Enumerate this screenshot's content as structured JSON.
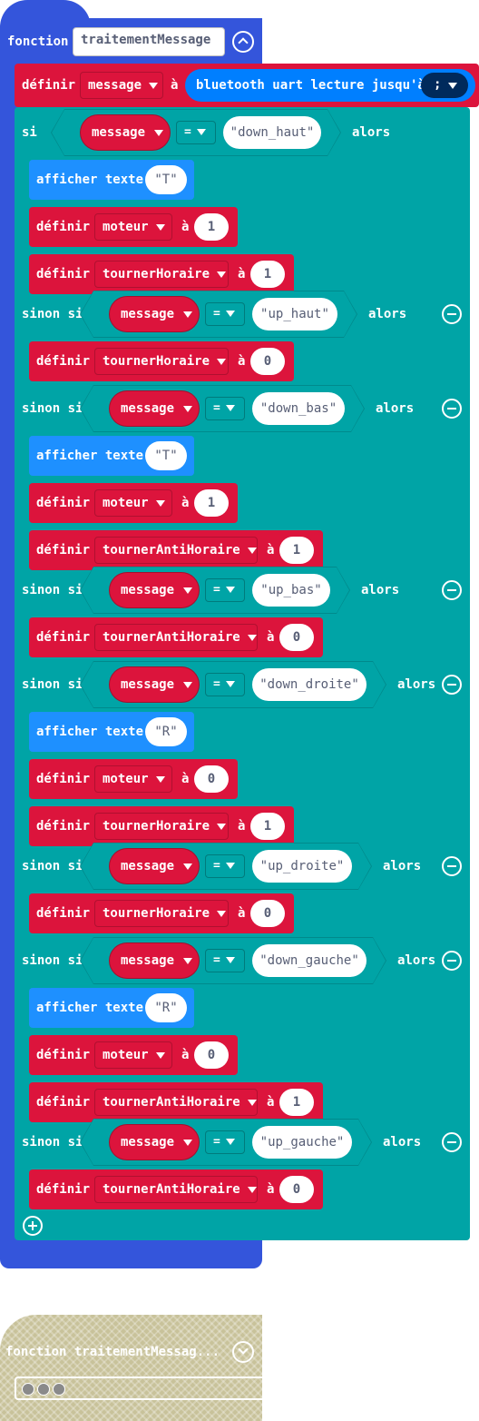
{
  "function_block": {
    "keyword": "fonction",
    "name": "traitementMessage",
    "collapse_icon": "chevron-up-icon"
  },
  "first_set": {
    "keyword": "définir",
    "variable": "message",
    "to": "à",
    "reader_block": "bluetooth uart lecture jusqu'à",
    "delimiter": ";"
  },
  "branches": [
    {
      "keyword": "si",
      "var": "message",
      "op": "=",
      "value": "down_haut",
      "then": "alors",
      "body": [
        {
          "type": "show",
          "label": "afficher texte",
          "text": "T"
        },
        {
          "type": "set",
          "label": "définir",
          "var": "moteur",
          "to": "à",
          "value": "1"
        },
        {
          "type": "set",
          "label": "définir",
          "var": "tournerHoraire",
          "to": "à",
          "value": "1"
        }
      ]
    },
    {
      "keyword": "sinon si",
      "var": "message",
      "op": "=",
      "value": "up_haut",
      "then": "alors",
      "body": [
        {
          "type": "set",
          "label": "définir",
          "var": "tournerHoraire",
          "to": "à",
          "value": "0"
        }
      ]
    },
    {
      "keyword": "sinon si",
      "var": "message",
      "op": "=",
      "value": "down_bas",
      "then": "alors",
      "body": [
        {
          "type": "show",
          "label": "afficher texte",
          "text": "T"
        },
        {
          "type": "set",
          "label": "définir",
          "var": "moteur",
          "to": "à",
          "value": "1"
        },
        {
          "type": "set",
          "label": "définir",
          "var": "tournerAntiHoraire",
          "to": "à",
          "value": "1"
        }
      ]
    },
    {
      "keyword": "sinon si",
      "var": "message",
      "op": "=",
      "value": "up_bas",
      "then": "alors",
      "body": [
        {
          "type": "set",
          "label": "définir",
          "var": "tournerAntiHoraire",
          "to": "à",
          "value": "0"
        }
      ]
    },
    {
      "keyword": "sinon si",
      "var": "message",
      "op": "=",
      "value": "down_droite",
      "then": "alors",
      "body": [
        {
          "type": "show",
          "label": "afficher texte",
          "text": "R"
        },
        {
          "type": "set",
          "label": "définir",
          "var": "moteur",
          "to": "à",
          "value": "0"
        },
        {
          "type": "set",
          "label": "définir",
          "var": "tournerHoraire",
          "to": "à",
          "value": "1"
        }
      ]
    },
    {
      "keyword": "sinon si",
      "var": "message",
      "op": "=",
      "value": "up_droite",
      "then": "alors",
      "body": [
        {
          "type": "set",
          "label": "définir",
          "var": "tournerHoraire",
          "to": "à",
          "value": "0"
        }
      ]
    },
    {
      "keyword": "sinon si",
      "var": "message",
      "op": "=",
      "value": "down_gauche",
      "then": "alors",
      "body": [
        {
          "type": "show",
          "label": "afficher texte",
          "text": "R"
        },
        {
          "type": "set",
          "label": "définir",
          "var": "moteur",
          "to": "à",
          "value": "0"
        },
        {
          "type": "set",
          "label": "définir",
          "var": "tournerAntiHoraire",
          "to": "à",
          "value": "1"
        }
      ]
    },
    {
      "keyword": "sinon si",
      "var": "message",
      "op": "=",
      "value": "up_gauche",
      "then": "alors",
      "body": [
        {
          "type": "set",
          "label": "définir",
          "var": "tournerAntiHoraire",
          "to": "à",
          "value": "0"
        }
      ]
    }
  ],
  "add_branch_icon": "plus-icon",
  "remove_branch_icon": "minus-icon",
  "collapsed_function": {
    "label": "fonction traitementMessag...",
    "expand_icon": "chevron-down-icon",
    "dots": "ellipsis-icon"
  },
  "colors": {
    "function": "#3455db",
    "logic": "#00a4a6",
    "variables": "#dc143c",
    "basic": "#1e90ff",
    "bluetooth": "#007fff",
    "collapsed": "#c8c29a"
  }
}
